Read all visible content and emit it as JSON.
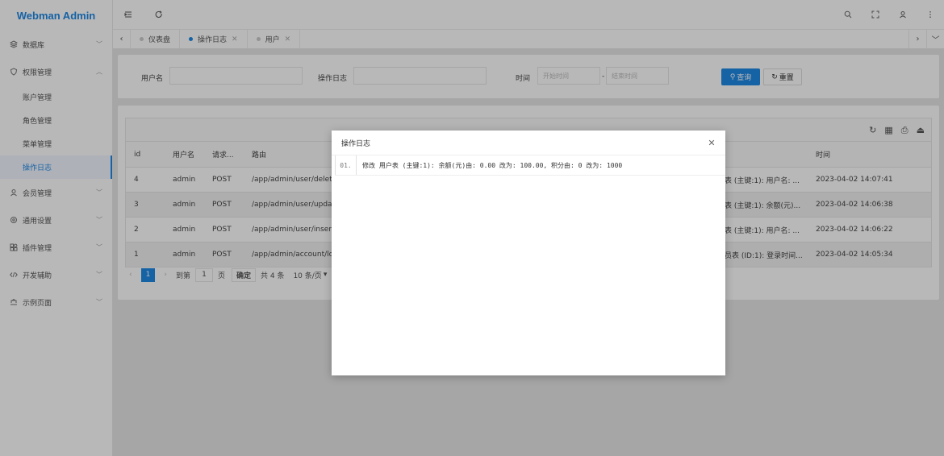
{
  "app": {
    "title": "Webman Admin"
  },
  "sidebar": {
    "items": [
      {
        "label": "数据库",
        "icon": "layers-icon",
        "expanded": false
      },
      {
        "label": "权限管理",
        "icon": "shield-icon",
        "expanded": true,
        "children": [
          {
            "label": "账户管理"
          },
          {
            "label": "角色管理"
          },
          {
            "label": "菜单管理"
          },
          {
            "label": "操作日志",
            "active": true
          }
        ]
      },
      {
        "label": "会员管理",
        "icon": "user-icon",
        "expanded": false
      },
      {
        "label": "通用设置",
        "icon": "gear-icon",
        "expanded": false
      },
      {
        "label": "插件管理",
        "icon": "plugin-icon",
        "expanded": false
      },
      {
        "label": "开发辅助",
        "icon": "code-icon",
        "expanded": false
      },
      {
        "label": "示例页面",
        "icon": "sample-icon",
        "expanded": false
      }
    ]
  },
  "tabs": [
    {
      "label": "仪表盘",
      "active": false
    },
    {
      "label": "操作日志",
      "active": true
    },
    {
      "label": "用户",
      "active": false
    }
  ],
  "search": {
    "username_label": "用户名",
    "log_label": "操作日志",
    "time_label": "时间",
    "start_placeholder": "开始时间",
    "end_placeholder": "结束时间",
    "dash": "-",
    "query_button": "查询",
    "reset_button": "重置"
  },
  "table": {
    "columns": [
      "id",
      "用户名",
      "请求...",
      "路由",
      "时间"
    ],
    "rows": [
      {
        "id": "4",
        "user": "admin",
        "method": "POST",
        "route": "/app/admin/user/delete",
        "log": "表 (主键:1): 用户名: ...",
        "time": "2023-04-02 14:07:41"
      },
      {
        "id": "3",
        "user": "admin",
        "method": "POST",
        "route": "/app/admin/user/update",
        "log": "表 (主键:1): 余额(元)...",
        "time": "2023-04-02 14:06:38"
      },
      {
        "id": "2",
        "user": "admin",
        "method": "POST",
        "route": "/app/admin/user/insert",
        "log": "表 (主键:1): 用户名: ...",
        "time": "2023-04-02 14:06:22"
      },
      {
        "id": "1",
        "user": "admin",
        "method": "POST",
        "route": "/app/admin/account/login",
        "log": "员表 (ID:1): 登录时间...",
        "time": "2023-04-02 14:05:34"
      }
    ]
  },
  "pager": {
    "current": "1",
    "goto_label": "到第",
    "goto_value": "1",
    "page_label": "页",
    "confirm": "确定",
    "total": "共 4 条",
    "per_page": "10 条/页"
  },
  "modal": {
    "title": "操作日志",
    "line_no": "01.",
    "content": "修改 用户表 (主键:1): 余额(元)由: 0.00 改为: 100.00, 积分由: 0 改为: 1000"
  }
}
